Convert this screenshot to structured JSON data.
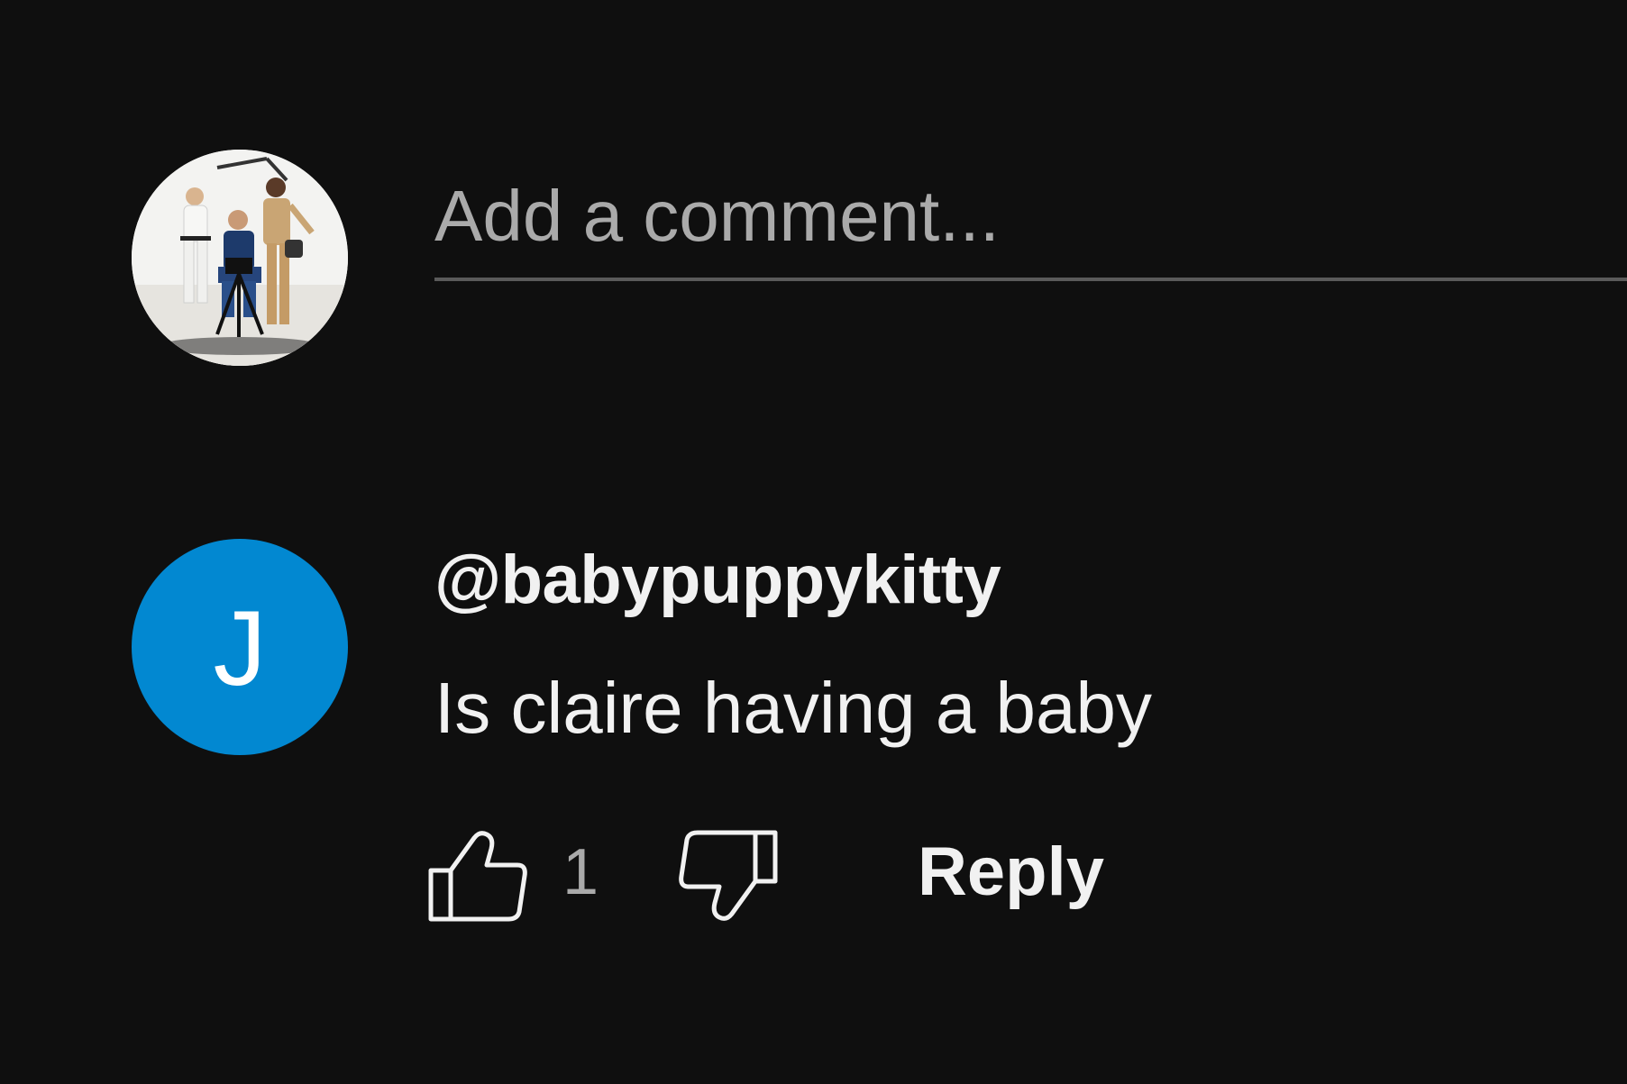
{
  "composer": {
    "avatar": "user-avatar-photo",
    "placeholder": "Add a comment..."
  },
  "comment": {
    "author_initial": "J",
    "author_avatar_color": "#0288d1",
    "author_handle": "@babypuppykitty",
    "text": "Is claire having a baby",
    "like_count": "1",
    "reply_label": "Reply",
    "like_icon": "thumbs-up-icon",
    "dislike_icon": "thumbs-down-icon"
  },
  "theme": {
    "background": "#0f0f0f",
    "text": "#f1f1f1",
    "muted_text": "#aaaaaa",
    "divider": "#5a5a5a"
  }
}
